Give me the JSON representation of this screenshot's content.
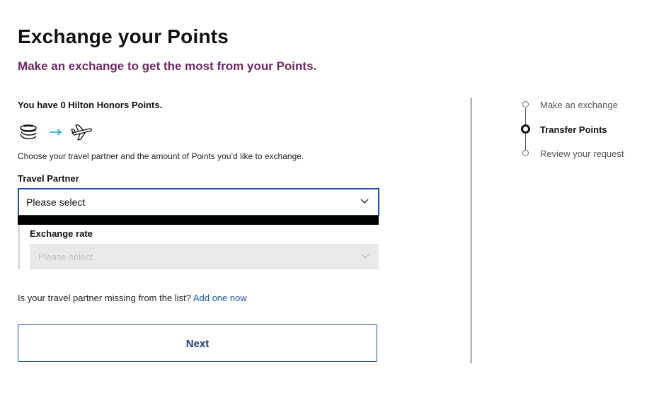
{
  "header": {
    "title": "Exchange your Points",
    "subtitle": "Make an exchange to get the most from your Points."
  },
  "balance": {
    "text": "You have 0 Hilton Honors Points."
  },
  "icons": [
    "coins-icon",
    "arrow-right-icon",
    "airplane-icon"
  ],
  "instruction": "Choose your travel partner and the amount of Points you’d like to exchange.",
  "travel_partner": {
    "label": "Travel Partner",
    "value": "Please select"
  },
  "exchange_rate": {
    "label": "Exchange rate",
    "value": "Please select"
  },
  "missing_partner": {
    "text": "Is your travel partner missing from the list?",
    "link": "Add one now"
  },
  "next_button": {
    "label": "Next"
  },
  "steps": [
    {
      "label": "Make an exchange",
      "state": "done"
    },
    {
      "label": "Transfer Points",
      "state": "current"
    },
    {
      "label": "Review your request",
      "state": "upcoming"
    }
  ],
  "colors": {
    "accent": "#1c4f9c",
    "subtitle": "#6e2a60",
    "link": "#1f5aa6",
    "arrow": "#2a9fd6"
  }
}
